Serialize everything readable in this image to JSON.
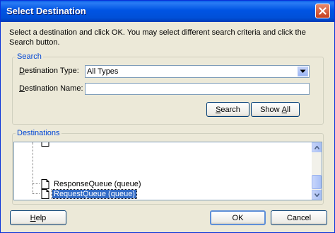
{
  "window": {
    "title": "Select Destination",
    "close_icon": "close-icon"
  },
  "instructions": "Select a destination and click OK. You may select different search criteria and click the Search button.",
  "search": {
    "legend": "Search",
    "destination_type_label_prefix": "",
    "destination_type_label_accel": "D",
    "destination_type_label_rest": "estination Type:",
    "destination_type_value": "All Types",
    "destination_name_label_prefix": "",
    "destination_name_label_accel": "D",
    "destination_name_label_rest": "estination Name:",
    "destination_name_value": "",
    "search_button_accel": "S",
    "search_button_rest": "earch",
    "showall_button_prefix": "Show ",
    "showall_button_accel": "A",
    "showall_button_rest": "ll"
  },
  "destinations": {
    "legend": "Destinations",
    "items": [
      {
        "label": "ResponseQueue (queue)",
        "selected": false
      },
      {
        "label": "RequestQueue (queue)",
        "selected": true
      }
    ]
  },
  "footer": {
    "help_accel": "H",
    "help_rest": "elp",
    "ok_label": "OK",
    "cancel_label": "Cancel"
  }
}
